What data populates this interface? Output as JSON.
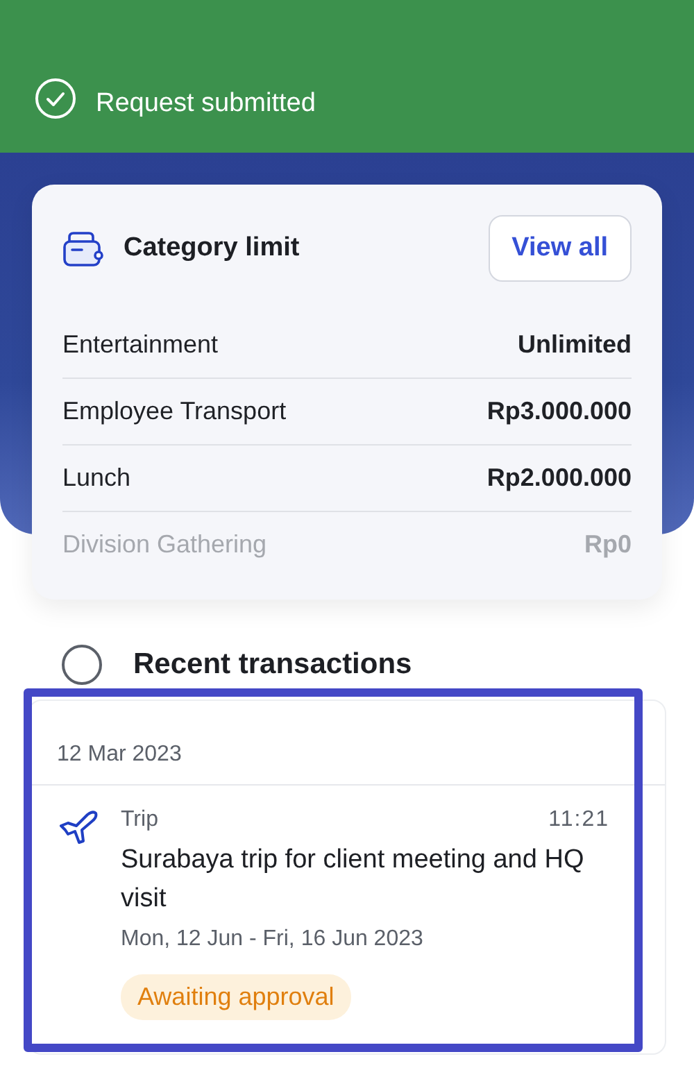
{
  "banner": {
    "text": "Request submitted"
  },
  "category_limit": {
    "title": "Category limit",
    "button": "View all",
    "rows": [
      {
        "name": "Entertainment",
        "amount": "Unlimited",
        "faded": false
      },
      {
        "name": "Employee Transport",
        "amount": "Rp3.000.000",
        "faded": false
      },
      {
        "name": "Lunch",
        "amount": "Rp2.000.000",
        "faded": false
      },
      {
        "name": "Division Gathering",
        "amount": "Rp0",
        "faded": true
      }
    ]
  },
  "recent": {
    "title": "Recent transactions",
    "groups": [
      {
        "date": "12 Mar 2023",
        "highlighted": true,
        "items": [
          {
            "category": "Trip",
            "time": "11:21",
            "title": "Surabaya trip for client meeting and HQ visit",
            "dates": "Mon, 12 Jun - Fri, 16 Jun 2023",
            "status": {
              "text": "Awaiting approval",
              "kind": "pending"
            }
          }
        ]
      }
    ]
  }
}
